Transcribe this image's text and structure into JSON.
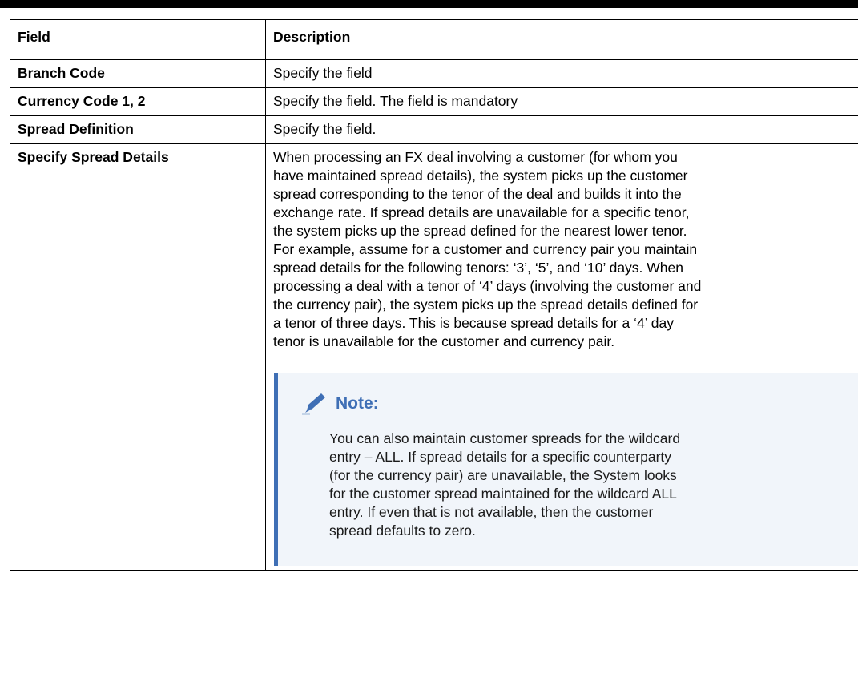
{
  "table": {
    "headers": [
      "Field",
      "Description"
    ],
    "rows": [
      {
        "field": "Branch Code",
        "description": "Specify the field"
      },
      {
        "field": "Currency Code 1, 2",
        "description": "Specify the field. The field is mandatory"
      },
      {
        "field": "Spread Definition",
        "description": "Specify the field."
      },
      {
        "field": "Specify Spread Details",
        "description_lines": [
          "When processing an FX deal involving a customer (for whom you",
          "have maintained spread details), the system picks up the customer",
          "spread corresponding to the tenor of the deal and builds it into the",
          "exchange rate. If spread details are unavailable for a specific tenor,",
          "the system picks up the spread defined for the nearest lower tenor.",
          "For example, assume for a customer and currency pair you maintain",
          "spread details for the following tenors: ‘3’, ‘5’, and ‘10’ days. When",
          "processing a deal with a tenor of ‘4’ days (involving the customer and",
          "the currency pair), the system picks up the spread details defined for",
          "a tenor of three days. This is because spread details for a ‘4’ day",
          "tenor is unavailable for the customer and currency pair."
        ],
        "note": {
          "title": "Note:",
          "lines": [
            "You can also maintain customer spreads for the wildcard",
            "entry – ALL. If spread details for a specific counterparty",
            "(for the currency pair) are unavailable, the System looks",
            "for the customer spread maintained for the wildcard ALL",
            "entry. If even that is not available, then the customer",
            "spread defaults to zero."
          ]
        }
      }
    ]
  },
  "colors": {
    "note_accent": "#3f6fb5",
    "note_background": "#f1f5fa"
  },
  "icons": {
    "note_icon": "pencil-icon"
  }
}
